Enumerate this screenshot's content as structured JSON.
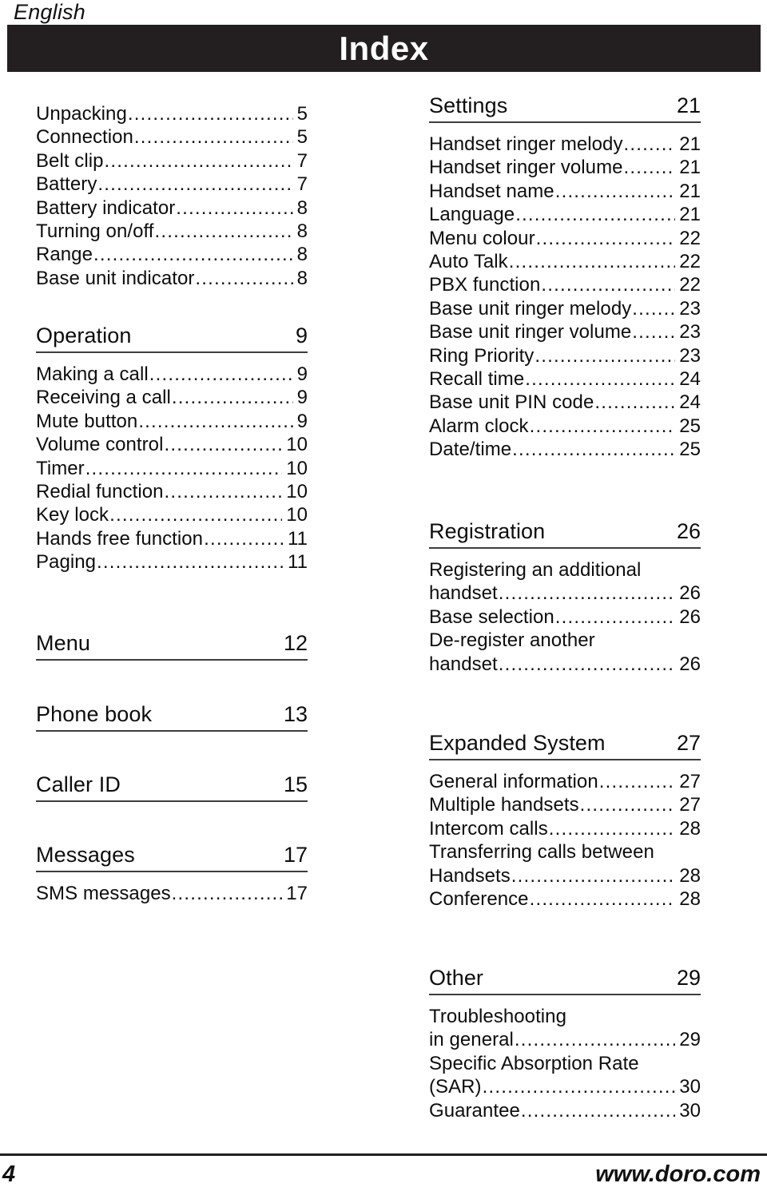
{
  "page": {
    "language_label": "English",
    "title": "Index",
    "title_bar_color": "#231f20",
    "text_color": "#0d0d0d",
    "background_color": "#ffffff"
  },
  "footer": {
    "page_number": "4",
    "website": "www.doro.com"
  },
  "columns": {
    "left": [
      {
        "type": "entries",
        "entries": [
          {
            "label": "Unpacking",
            "page": "5"
          },
          {
            "label": "Connection",
            "page": "5"
          },
          {
            "label": "Belt clip",
            "page": "7"
          },
          {
            "label": "Battery",
            "page": "7"
          },
          {
            "label": "Battery indicator",
            "page": "8"
          },
          {
            "label": "Turning on/off",
            "page": "8"
          },
          {
            "label": "Range",
            "page": "8"
          },
          {
            "label": "Base unit indicator",
            "page": "8"
          }
        ]
      },
      {
        "type": "section",
        "heading": "Operation",
        "heading_page": "9",
        "entries": [
          {
            "label": "Making a call",
            "page": "9"
          },
          {
            "label": "Receiving a call",
            "page": "9"
          },
          {
            "label": "Mute button",
            "page": "9"
          },
          {
            "label": "Volume control",
            "page": "10"
          },
          {
            "label": "Timer",
            "page": "10"
          },
          {
            "label": "Redial function",
            "page": "10"
          },
          {
            "label": "Key lock",
            "page": "10"
          },
          {
            "label": "Hands free function",
            "page": "11"
          },
          {
            "label": "Paging",
            "page": "11"
          }
        ]
      },
      {
        "type": "section",
        "heading": "Menu",
        "heading_page": "12",
        "entries": []
      },
      {
        "type": "section",
        "heading": "Phone book",
        "heading_page": "13",
        "entries": []
      },
      {
        "type": "section",
        "heading": "Caller ID",
        "heading_page": "15",
        "entries": []
      },
      {
        "type": "section",
        "heading": "Messages",
        "heading_page": "17",
        "entries": [
          {
            "label": "SMS messages",
            "page": "17"
          }
        ]
      }
    ],
    "right": [
      {
        "type": "section",
        "heading": "Settings",
        "heading_page": "21",
        "entries": [
          {
            "label": "Handset ringer melody",
            "page": "21"
          },
          {
            "label": "Handset ringer volume",
            "page": "21"
          },
          {
            "label": "Handset name",
            "page": "21"
          },
          {
            "label": "Language",
            "page": "21"
          },
          {
            "label": "Menu colour",
            "page": "22"
          },
          {
            "label": "Auto Talk",
            "page": "22"
          },
          {
            "label": "PBX function",
            "page": "22"
          },
          {
            "label": "Base unit ringer melody",
            "page": "23"
          },
          {
            "label": "Base unit ringer volume",
            "page": "23"
          },
          {
            "label": "Ring Priority",
            "page": "23"
          },
          {
            "label": "Recall time",
            "page": "24"
          },
          {
            "label": "Base unit PIN code",
            "page": "24"
          },
          {
            "label": "Alarm clock",
            "page": "25"
          },
          {
            "label": "Date/time",
            "page": "25"
          }
        ]
      },
      {
        "type": "section",
        "heading": "Registration",
        "heading_page": "26",
        "entries": [
          {
            "first_line": "Registering an additional",
            "label": "handset",
            "page": "26"
          },
          {
            "label": "Base selection",
            "page": "26"
          },
          {
            "first_line": "De-register another",
            "label": "handset",
            "page": "26"
          }
        ]
      },
      {
        "type": "section",
        "heading": "Expanded System",
        "heading_page": "27",
        "entries": [
          {
            "label": "General information",
            "page": "27"
          },
          {
            "label": "Multiple handsets",
            "page": "27"
          },
          {
            "label": "Intercom calls",
            "page": "28"
          },
          {
            "first_line": "Transferring calls between",
            "label": "Handsets",
            "page": "28"
          },
          {
            "label": "Conference",
            "page": "28"
          }
        ]
      },
      {
        "type": "section",
        "heading": "Other",
        "heading_page": "29",
        "entries": [
          {
            "first_line": "Troubleshooting",
            "label": "in general",
            "page": "29"
          },
          {
            "first_line": "Specific Absorption Rate",
            "label": "(SAR)",
            "page": "30"
          },
          {
            "label": "Guarantee",
            "page": "30"
          }
        ]
      }
    ]
  }
}
